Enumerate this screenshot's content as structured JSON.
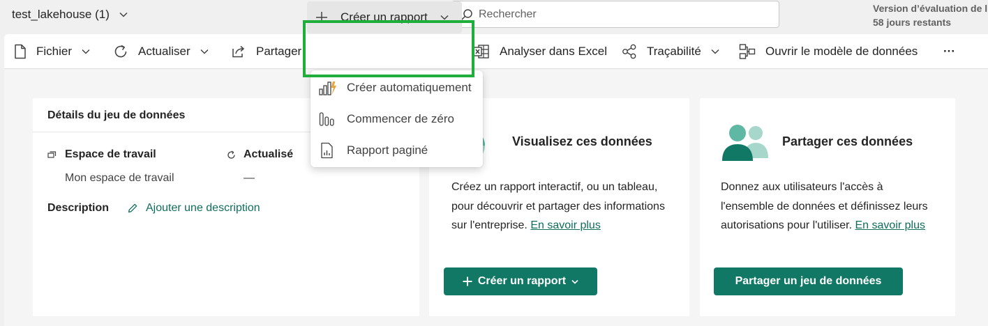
{
  "header": {
    "workspace_title": "test_lakehouse (1)",
    "search_placeholder": "Rechercher",
    "trial_line1": "Version d’évaluation de l",
    "trial_line2": "58 jours restants"
  },
  "ribbon": {
    "file": "Fichier",
    "refresh": "Actualiser",
    "share": "Partager",
    "create_report": "Créer un rapport",
    "analyze_excel": "Analyser dans Excel",
    "lineage": "Traçabilité",
    "open_model": "Ouvrir le modèle de données",
    "more": "···"
  },
  "dropdown": {
    "items": [
      {
        "label": "Créer automatiquement",
        "icon": "auto-create-chart-icon"
      },
      {
        "label": "Commencer de zéro",
        "icon": "bars-outline-icon"
      },
      {
        "label": "Rapport paginé",
        "icon": "paginated-report-icon"
      }
    ]
  },
  "details": {
    "title": "Détails du jeu de données",
    "workspace_label": "Espace de travail",
    "workspace_value": "Mon espace de travail",
    "refreshed_label": "Actualisé",
    "refreshed_value": "—",
    "description_label": "Description",
    "add_description": "Ajouter une description"
  },
  "visualize": {
    "title": "Visualisez ces données",
    "text": "Créez un rapport interactif, ou un tableau, pour découvrir et partager des informations sur l'entreprise.",
    "link": "En savoir plus",
    "button": "Créer un rapport"
  },
  "share": {
    "title": "Partager ces données",
    "text": "Donnez aux utilisateurs l'accès à l'ensemble de données et définissez leurs autorisations pour l'utiliser.",
    "link": "En savoir plus",
    "button": "Partager un jeu de données"
  },
  "colors": {
    "accent": "#117865",
    "link": "#0f6c5c",
    "highlight": "#1fae3c",
    "chart_orange": "#e8a33d"
  }
}
